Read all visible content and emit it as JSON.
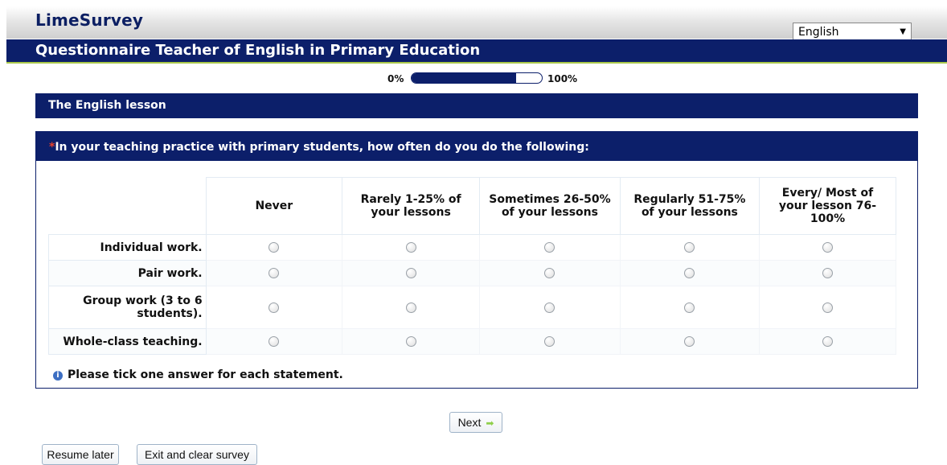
{
  "header": {
    "brand": "LimeSurvey",
    "language_selected": "English",
    "survey_title": "Questionnaire Teacher of English in Primary Education"
  },
  "progress": {
    "min_label": "0%",
    "max_label": "100%",
    "value_percent": 80
  },
  "group": {
    "title": "The English lesson"
  },
  "question": {
    "mandatory_mark": "*",
    "text": "In your teaching practice with primary students, how often do you do the following:",
    "columns": [
      "Never",
      "Rarely 1-25% of your lessons",
      "Sometimes 26-50% of your lessons",
      "Regularly 51-75% of your lessons",
      "Every/ Most of your lesson 76-100%"
    ],
    "rows": [
      "Individual work.",
      "Pair work.",
      "Group work (3 to 6 students).",
      "Whole-class teaching."
    ],
    "tip": "Please tick one answer for each statement."
  },
  "buttons": {
    "next": "Next",
    "resume_later": "Resume later",
    "exit_clear": "Exit and clear survey"
  },
  "icons": {
    "dropdown": "chevron-down-icon",
    "tip": "info-icon",
    "next": "arrow-right-icon"
  },
  "colors": {
    "primary": "#0c1f6a",
    "accent": "#a9c84a",
    "mandatory": "#e8412a"
  }
}
